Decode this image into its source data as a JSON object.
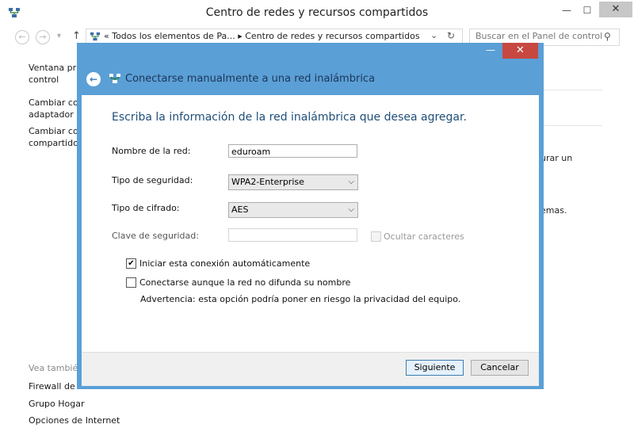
{
  "window": {
    "title": "Centro de redes y recursos compartidos",
    "minimize_glyph": "—",
    "maximize_glyph": "☐",
    "close_glyph": "✕"
  },
  "nav": {
    "back_glyph": "←",
    "forward_glyph": "→",
    "dropdown_glyph": "▾",
    "up_glyph": "↑",
    "address_path": "«  Todos los elementos de Pa...  ▸  Centro de redes y recursos compartidos",
    "address_dropdown_glyph": "⌄",
    "refresh_glyph": "↻",
    "search_placeholder": "Buscar en el Panel de control",
    "search_icon_glyph": "⚲"
  },
  "sidebar": {
    "items": [
      {
        "line1": "Ventana prin",
        "line2": "control"
      },
      {
        "line1": "Cambiar cor",
        "line2": "adaptador"
      },
      {
        "line1": "Cambiar cor",
        "line2": "compartido"
      }
    ],
    "see_also_heading": "Vea también",
    "see_also": [
      "Firewall de W",
      "Grupo Hogar",
      "Opciones de Internet"
    ]
  },
  "right_fragments": [
    "urar un",
    "emas."
  ],
  "dialog": {
    "title": "Conectarse manualmente a una red inalámbrica",
    "back_glyph": "←",
    "minimize_glyph": "—",
    "close_glyph": "✕",
    "heading": "Escriba la información de la red inalámbrica que desea agregar.",
    "fields": {
      "network_name_label": "Nombre de la red:",
      "network_name_value": "eduroam",
      "security_type_label": "Tipo de seguridad:",
      "security_type_value": "WPA2-Enterprise",
      "encryption_type_label": "Tipo de cifrado:",
      "encryption_type_value": "AES",
      "security_key_label": "Clave de seguridad:",
      "security_key_value": "",
      "hide_characters_label": "Ocultar caracteres"
    },
    "options": {
      "auto_connect_label": "Iniciar esta conexión automáticamente",
      "auto_connect_checked": "✔",
      "connect_hidden_label": "Conectarse aunque la red no difunda su nombre",
      "warning": "Advertencia: esta opción podría poner en riesgo la privacidad del equipo."
    },
    "buttons": {
      "next": "Siguiente",
      "cancel": "Cancelar"
    },
    "combo_arrow_glyph": "⌵"
  },
  "colors": {
    "dialog_frame": "#5a9fd6",
    "close_button": "#c74840",
    "heading_text": "#1f4e79"
  }
}
